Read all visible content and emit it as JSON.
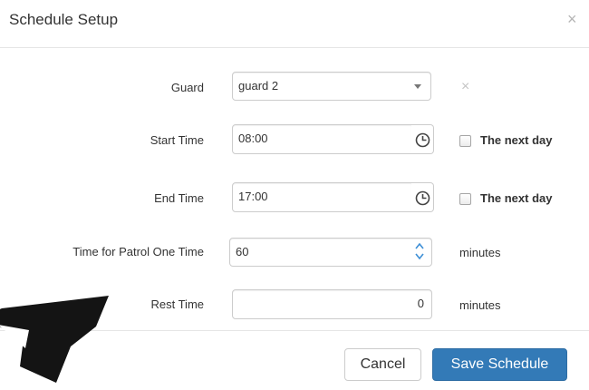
{
  "dialog": {
    "title": "Schedule Setup",
    "close_glyph": "×"
  },
  "form": {
    "guard": {
      "label": "Guard",
      "selected": "guard 2",
      "clear_glyph": "×"
    },
    "start_time": {
      "label": "Start Time",
      "value": "08:00",
      "next_day_label": "The next day",
      "next_day_checked": false
    },
    "end_time": {
      "label": "End Time",
      "value": "17:00",
      "next_day_label": "The next day",
      "next_day_checked": false
    },
    "patrol_time": {
      "label": "Time for Patrol One Time",
      "value": "60",
      "unit": "minutes"
    },
    "rest_time": {
      "label": "Rest Time",
      "value": "0",
      "unit": "minutes"
    }
  },
  "footer": {
    "cancel_label": "Cancel",
    "save_label": "Save Schedule"
  },
  "colors": {
    "primary": "#337ab7",
    "border": "#cccccc"
  },
  "icons": [
    "close-icon",
    "dropdown-caret-icon",
    "clear-icon",
    "clock-icon",
    "spinner-arrows-icon",
    "mouse-pointer-icon"
  ]
}
